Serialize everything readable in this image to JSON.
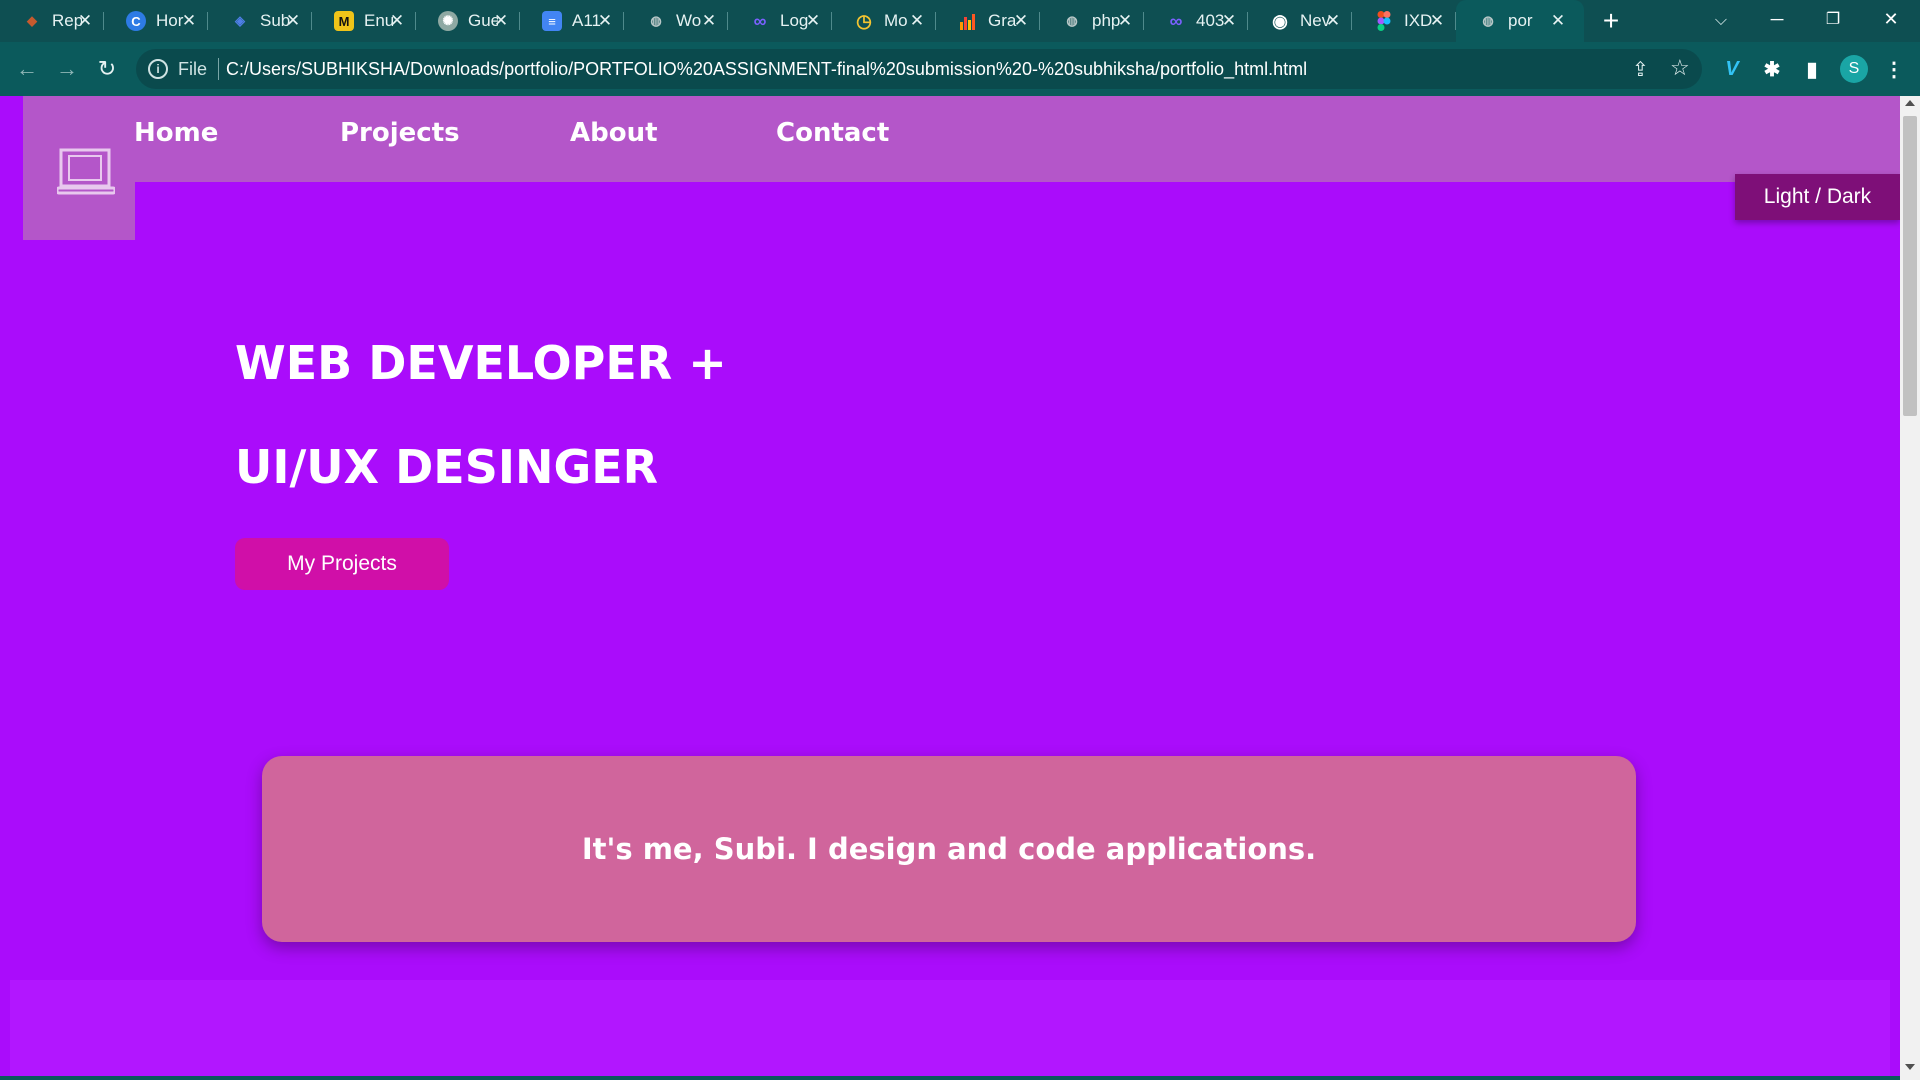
{
  "browser": {
    "tabs": [
      {
        "title": "Rep",
        "icon": "diamond-icon",
        "icon_glyph": "◆",
        "icon_color": "#c65a2e",
        "active": false
      },
      {
        "title": "Hor",
        "icon": "c-logo-icon",
        "icon_glyph": "C",
        "icon_color": "#2d7be5",
        "active": false
      },
      {
        "title": "Sub",
        "icon": "shield-icon",
        "icon_glyph": "◈",
        "icon_color": "#4f7fe8",
        "active": false
      },
      {
        "title": "Enu",
        "icon": "m-logo-icon",
        "icon_glyph": "M",
        "icon_color": "#f0c419",
        "active": false
      },
      {
        "title": "Gue",
        "icon": "openai-icon",
        "icon_glyph": "✺",
        "icon_color": "#8fa9a3",
        "active": false
      },
      {
        "title": "A11",
        "icon": "docs-icon",
        "icon_glyph": "≡",
        "icon_color": "#4285f4",
        "active": false
      },
      {
        "title": "Wo",
        "icon": "globe-icon",
        "icon_glyph": "◍",
        "icon_color": "#b8c7c7",
        "active": false
      },
      {
        "title": "Log",
        "icon": "infinity-icon",
        "icon_glyph": "∞",
        "icon_color": "#7b61ff",
        "active": false
      },
      {
        "title": "Mo",
        "icon": "stopwatch-icon",
        "icon_glyph": "◷",
        "icon_color": "#f4c430",
        "active": false
      },
      {
        "title": "Gra",
        "icon": "bar-chart-icon",
        "icon_glyph": "▮",
        "icon_color": "#ff9800",
        "active": false
      },
      {
        "title": "php",
        "icon": "globe-icon",
        "icon_glyph": "◍",
        "icon_color": "#b8c7c7",
        "active": false
      },
      {
        "title": "403",
        "icon": "infinity-icon",
        "icon_glyph": "∞",
        "icon_color": "#7b61ff",
        "active": false
      },
      {
        "title": "Nev",
        "icon": "chrome-icon",
        "icon_glyph": "◉",
        "icon_color": "#ffffff",
        "active": false
      },
      {
        "title": "IXD",
        "icon": "figma-icon",
        "icon_glyph": "❖",
        "icon_color": "#f24e1e",
        "active": false
      },
      {
        "title": "por",
        "icon": "globe-icon",
        "icon_glyph": "◍",
        "icon_color": "#b8c7c7",
        "active": true
      }
    ],
    "new_tab_label": "+",
    "tab_search_label": "⌵",
    "window_controls": {
      "minimize": "─",
      "restore": "❐",
      "close": "✕"
    },
    "nav": {
      "back": "←",
      "forward": "→",
      "reload": "↻"
    },
    "address": {
      "info_glyph": "i",
      "scheme_label": "File",
      "url": "C:/Users/SUBHIKSHA/Downloads/portfolio/PORTFOLIO%20ASSIGNMENT-final%20submission%20-%20subhiksha/portfolio_html.html",
      "share_glyph": "⇪",
      "star_glyph": "☆"
    },
    "toolbar_icons": {
      "vimeo": "V",
      "extensions": "✱",
      "sidepanel": "▮",
      "menu": "⋮"
    },
    "profile_initial": "S"
  },
  "page": {
    "nav_links": [
      "Home",
      "Projects",
      "About",
      "Contact"
    ],
    "theme_toggle_label": "Light / Dark",
    "hero": {
      "line1": "WEB DEVELOPER +",
      "line2": "UI/UX DESINGER",
      "cta_label": "My Projects"
    },
    "intro_text": "It's me, Subi. I design and code applications.",
    "colors": {
      "page_background": "#aa0cfb",
      "nav_background": "#b456c9",
      "theme_toggle": "#7e0f78",
      "cta_button": "#d00fa8",
      "intro_card": "#d0659c",
      "browser_chrome": "#0b5a5c"
    }
  }
}
